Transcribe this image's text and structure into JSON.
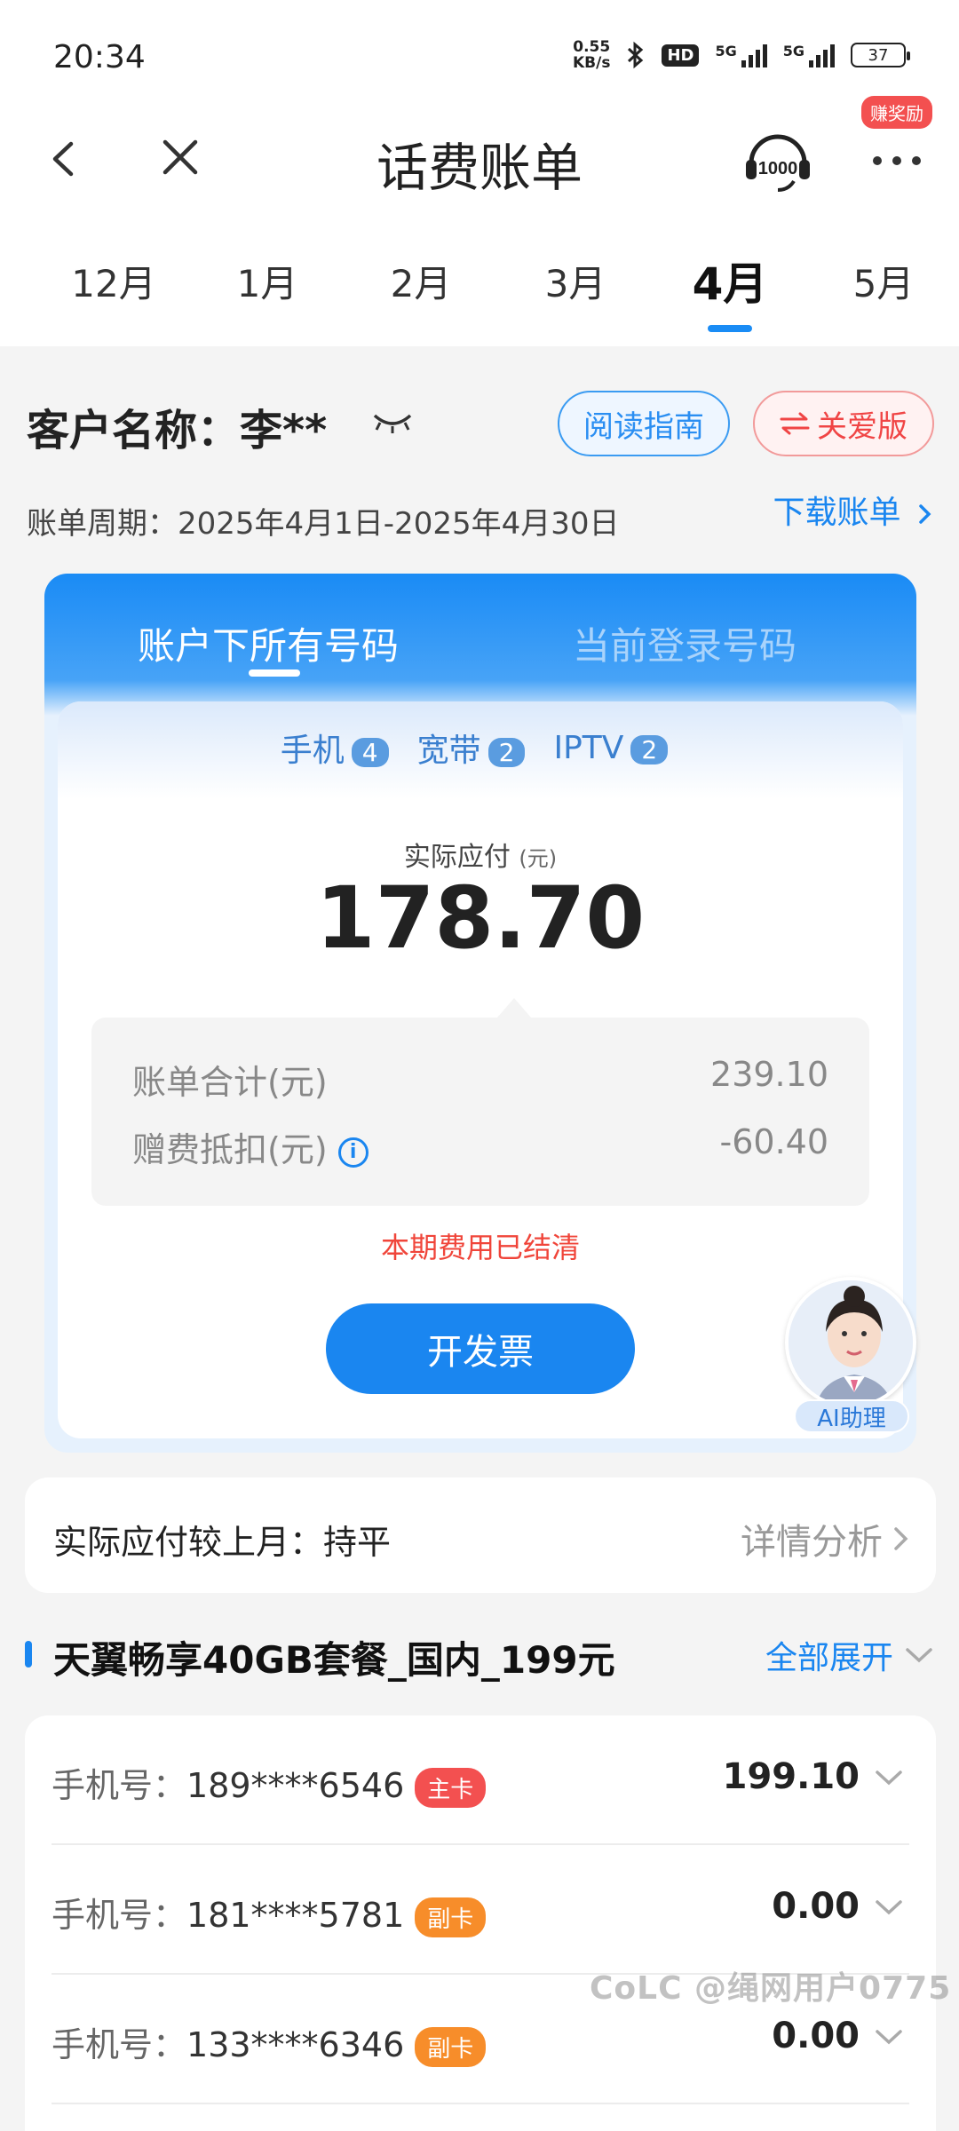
{
  "status_bar": {
    "time": "20:34",
    "net_speed_value": "0.55",
    "net_speed_unit": "KB/s",
    "hd_label": "HD",
    "sim1": "5G",
    "sim2": "5G",
    "battery": "37"
  },
  "header": {
    "title": "话费账单",
    "reward_badge": "赚奖励",
    "service_icon": "10000-hotline-icon"
  },
  "month_tabs": [
    {
      "label": "12月",
      "active": false
    },
    {
      "label": "1月",
      "active": false
    },
    {
      "label": "2月",
      "active": false
    },
    {
      "label": "3月",
      "active": false
    },
    {
      "label": "4月",
      "active": true
    },
    {
      "label": "5月",
      "active": false
    }
  ],
  "customer": {
    "name_label": "客户名称：李**",
    "guide_button": "阅读指南",
    "care_button": "关爱版",
    "period": "账单周期：2025年4月1日-2025年4月30日",
    "download": "下载账单"
  },
  "bill_card": {
    "tab_all": "账户下所有号码",
    "tab_current": "当前登录号码",
    "categories": [
      {
        "label": "手机",
        "count": "4"
      },
      {
        "label": "宽带",
        "count": "2"
      },
      {
        "label": "IPTV",
        "count": "2"
      }
    ],
    "pay_label": "实际应付",
    "pay_unit": "(元)",
    "pay_amount": "178.70",
    "total_label": "账单合计(元)",
    "total_value": "239.10",
    "discount_label": "赠费抵扣(元)",
    "discount_value": "-60.40",
    "settled_text": "本期费用已结清",
    "invoice_button": "开发票"
  },
  "ai_assistant": {
    "label": "AI助理"
  },
  "compare": {
    "label": "实际应付较上月：持平",
    "action": "详情分析"
  },
  "plan": {
    "name": "天翼畅享40GB套餐_国内_199元",
    "expand": "全部展开"
  },
  "lines": [
    {
      "label": "手机号：",
      "number": "189****6546",
      "tag": "主卡",
      "tag_type": "main",
      "amount": "199.10"
    },
    {
      "label": "手机号：",
      "number": "181****5781",
      "tag": "副卡",
      "tag_type": "sub",
      "amount": "0.00"
    },
    {
      "label": "手机号：",
      "number": "133****6346",
      "tag": "副卡",
      "tag_type": "sub",
      "amount": "0.00"
    }
  ],
  "watermark": "CoLC @绳网用户0775",
  "colors": {
    "accent": "#1a86f0",
    "danger": "#f0453a",
    "tag_main": "#f35050",
    "tag_sub": "#f78d2a"
  }
}
